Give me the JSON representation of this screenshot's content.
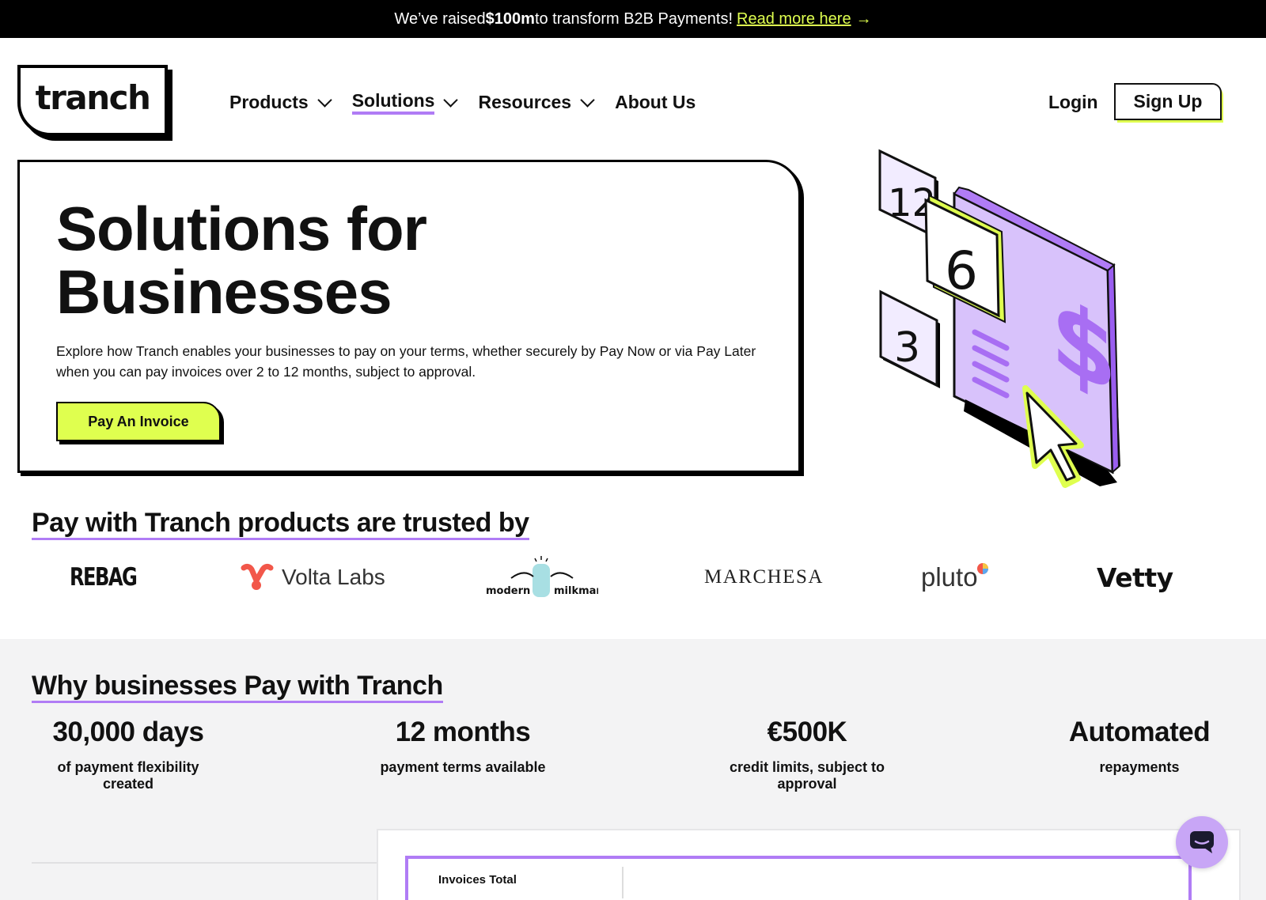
{
  "banner": {
    "text_prefix": "We’ve raised ",
    "text_bold": "$100m",
    "text_suffix": " to transform B2B Payments!",
    "link": "Read more here",
    "arrow": "→"
  },
  "brand": {
    "name": "tranch"
  },
  "nav": {
    "items": [
      {
        "label": "Products",
        "has_dropdown": true
      },
      {
        "label": "Solutions",
        "has_dropdown": true,
        "active": true
      },
      {
        "label": "Resources",
        "has_dropdown": true
      },
      {
        "label": "About Us",
        "has_dropdown": false
      }
    ],
    "login": "Login",
    "signup": "Sign Up"
  },
  "hero": {
    "title_line1": "Solutions for",
    "title_line2": "Businesses",
    "description": "Explore how Tranch enables your businesses to pay on your terms, whether securely by Pay Now or via Pay Later when you can pay invoices over 2 to 12 months, subject to approval.",
    "cta": "Pay An Invoice"
  },
  "illustration": {
    "tiles": [
      "12",
      "6",
      "3"
    ],
    "symbol": "$"
  },
  "trusted": {
    "title": "Pay with Tranch products are trusted by",
    "logos": [
      "REBAG",
      "Volta Labs",
      "modern",
      "milkman",
      "MARCHESA",
      "pluto",
      "Vetty"
    ]
  },
  "why": {
    "title": "Why businesses Pay with Tranch",
    "stats": [
      {
        "value": "30,000 days",
        "label": "of payment flexibility created"
      },
      {
        "value": "12 months",
        "label": "payment terms available"
      },
      {
        "value": "€500K",
        "label": "credit limits, subject to approval"
      },
      {
        "value": "Automated",
        "label": "repayments"
      }
    ]
  },
  "preview": {
    "label": "Invoices Total"
  },
  "colors": {
    "accent_lime": "#dfff4f",
    "accent_purple": "#b07cf5",
    "banner_bg": "#000000",
    "section_bg": "#f3f3f4"
  },
  "icons": {
    "chat": "chat-bubble-icon",
    "dropdown": "chevron-down-icon",
    "arrow": "arrow-right-icon"
  }
}
